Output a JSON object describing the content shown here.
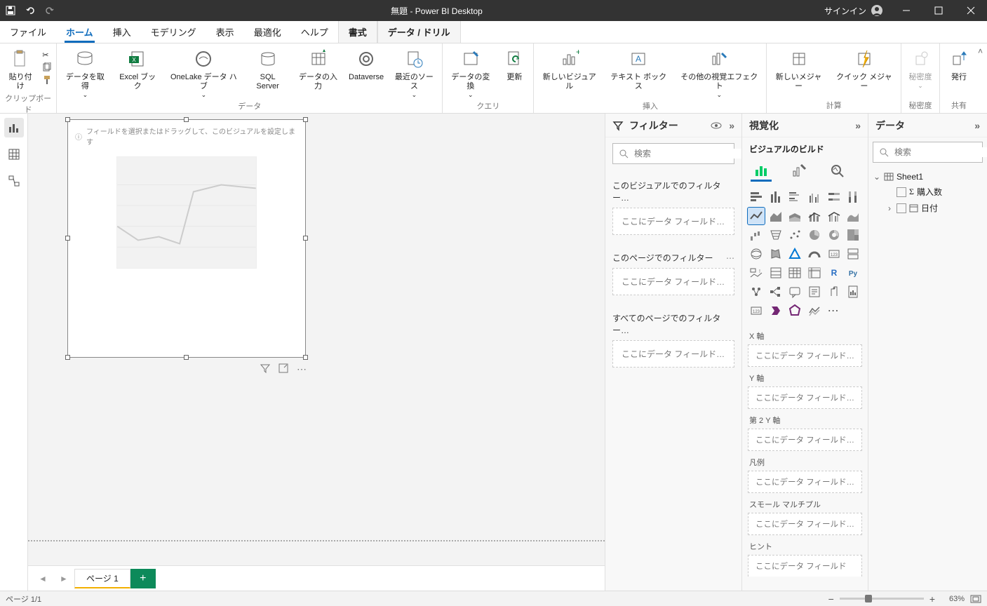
{
  "title": "無題 - Power BI Desktop",
  "signin": "サインイン",
  "menus": {
    "file": "ファイル",
    "home": "ホーム",
    "insert": "挿入",
    "modeling": "モデリング",
    "view": "表示",
    "optimize": "最適化",
    "help": "ヘルプ",
    "format": "書式",
    "data_drill": "データ / ドリル"
  },
  "ribbon": {
    "clipboard": {
      "paste": "貼り付け",
      "label": "クリップボード"
    },
    "data": {
      "get": "データを取得",
      "excel": "Excel ブック",
      "onelake": "OneLake データ ハブ",
      "sql": "SQL Server",
      "enter": "データの入力",
      "dataverse": "Dataverse",
      "recent": "最近のソース",
      "label": "データ"
    },
    "query": {
      "transform": "データの変換",
      "refresh": "更新",
      "label": "クエリ"
    },
    "insert": {
      "newVisual": "新しいビジュアル",
      "textBox": "テキスト ボックス",
      "moreVisuals": "その他の視覚エフェクト",
      "label": "挿入"
    },
    "calc": {
      "newMeasure": "新しいメジャー",
      "quickMeasure": "クイック メジャー",
      "label": "計算"
    },
    "sensitivity": {
      "btn": "秘密度",
      "label": "秘密度"
    },
    "share": {
      "publish": "発行",
      "label": "共有"
    }
  },
  "canvas": {
    "hint": "フィールドを選択またはドラッグして、このビジュアルを設定します"
  },
  "pagetabs": {
    "page1": "ページ 1"
  },
  "filters": {
    "title": "フィルター",
    "search": "検索",
    "visual": "このビジュアルでのフィルター…",
    "page": "このページでのフィルター",
    "all": "すべてのページでのフィルター…",
    "drop": "ここにデータ フィールド…"
  },
  "viz": {
    "title": "視覚化",
    "build": "ビジュアルのビルド",
    "wells": {
      "x": "X 軸",
      "y": "Y 軸",
      "y2": "第 2 Y 軸",
      "legend": "凡例",
      "sm": "スモール マルチプル",
      "tooltip": "ヒント",
      "drop": "ここにデータ フィールド…",
      "dropCut": "ここにデータ フィールド"
    }
  },
  "data": {
    "title": "データ",
    "search": "検索",
    "table": "Sheet1",
    "field1": "購入数",
    "field2": "日付"
  },
  "status": {
    "page": "ページ 1/1",
    "zoom": "63%"
  }
}
